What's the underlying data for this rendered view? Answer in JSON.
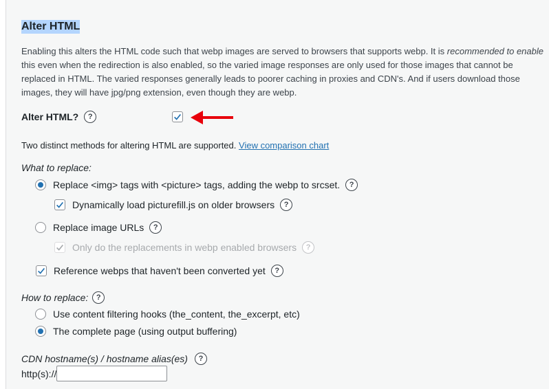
{
  "section": {
    "title": "Alter HTML",
    "desc_part1": "Enabling this alters the HTML code such that webp images are served to browsers that supports webp. It is ",
    "desc_em": "recommended to enable",
    "desc_part2": " this even when the redirection is also enabled, so the varied image responses are only used for those images that cannot be replaced in HTML. The varied responses generally leads to poorer caching in proxies and CDN's. And if users download those images, they will have jpg/png extension, even though they are webp."
  },
  "alter_html": {
    "label": "Alter HTML?",
    "checked": true
  },
  "methods": {
    "text": "Two distinct methods for altering HTML are supported.",
    "link": "View comparison chart"
  },
  "what_to_replace": {
    "label": "What to replace:",
    "options": [
      {
        "label": "Replace <img> tags with <picture> tags, adding the webp to srcset.",
        "selected": true
      },
      {
        "label": "Replace image URLs",
        "selected": false
      }
    ],
    "picturefill": {
      "label": "Dynamically load picturefill.js on older browsers",
      "checked": true
    },
    "only_webp": {
      "label": "Only do the replacements in webp enabled browsers",
      "checked": true,
      "disabled": true
    },
    "reference": {
      "label": "Reference webps that haven't been converted yet",
      "checked": true
    }
  },
  "how_to_replace": {
    "label": "How to replace:",
    "options": [
      {
        "label": "Use content filtering hooks (the_content, the_excerpt, etc)",
        "selected": false
      },
      {
        "label": "The complete page (using output buffering)",
        "selected": true
      }
    ]
  },
  "cdn": {
    "label": "CDN hostname(s) / hostname alias(es)",
    "prefix": "http(s)://",
    "value": ""
  },
  "help_glyph": "?",
  "colors": {
    "accent": "#2271b1",
    "arrow": "#e8000b",
    "highlight": "#b4d5fe"
  }
}
